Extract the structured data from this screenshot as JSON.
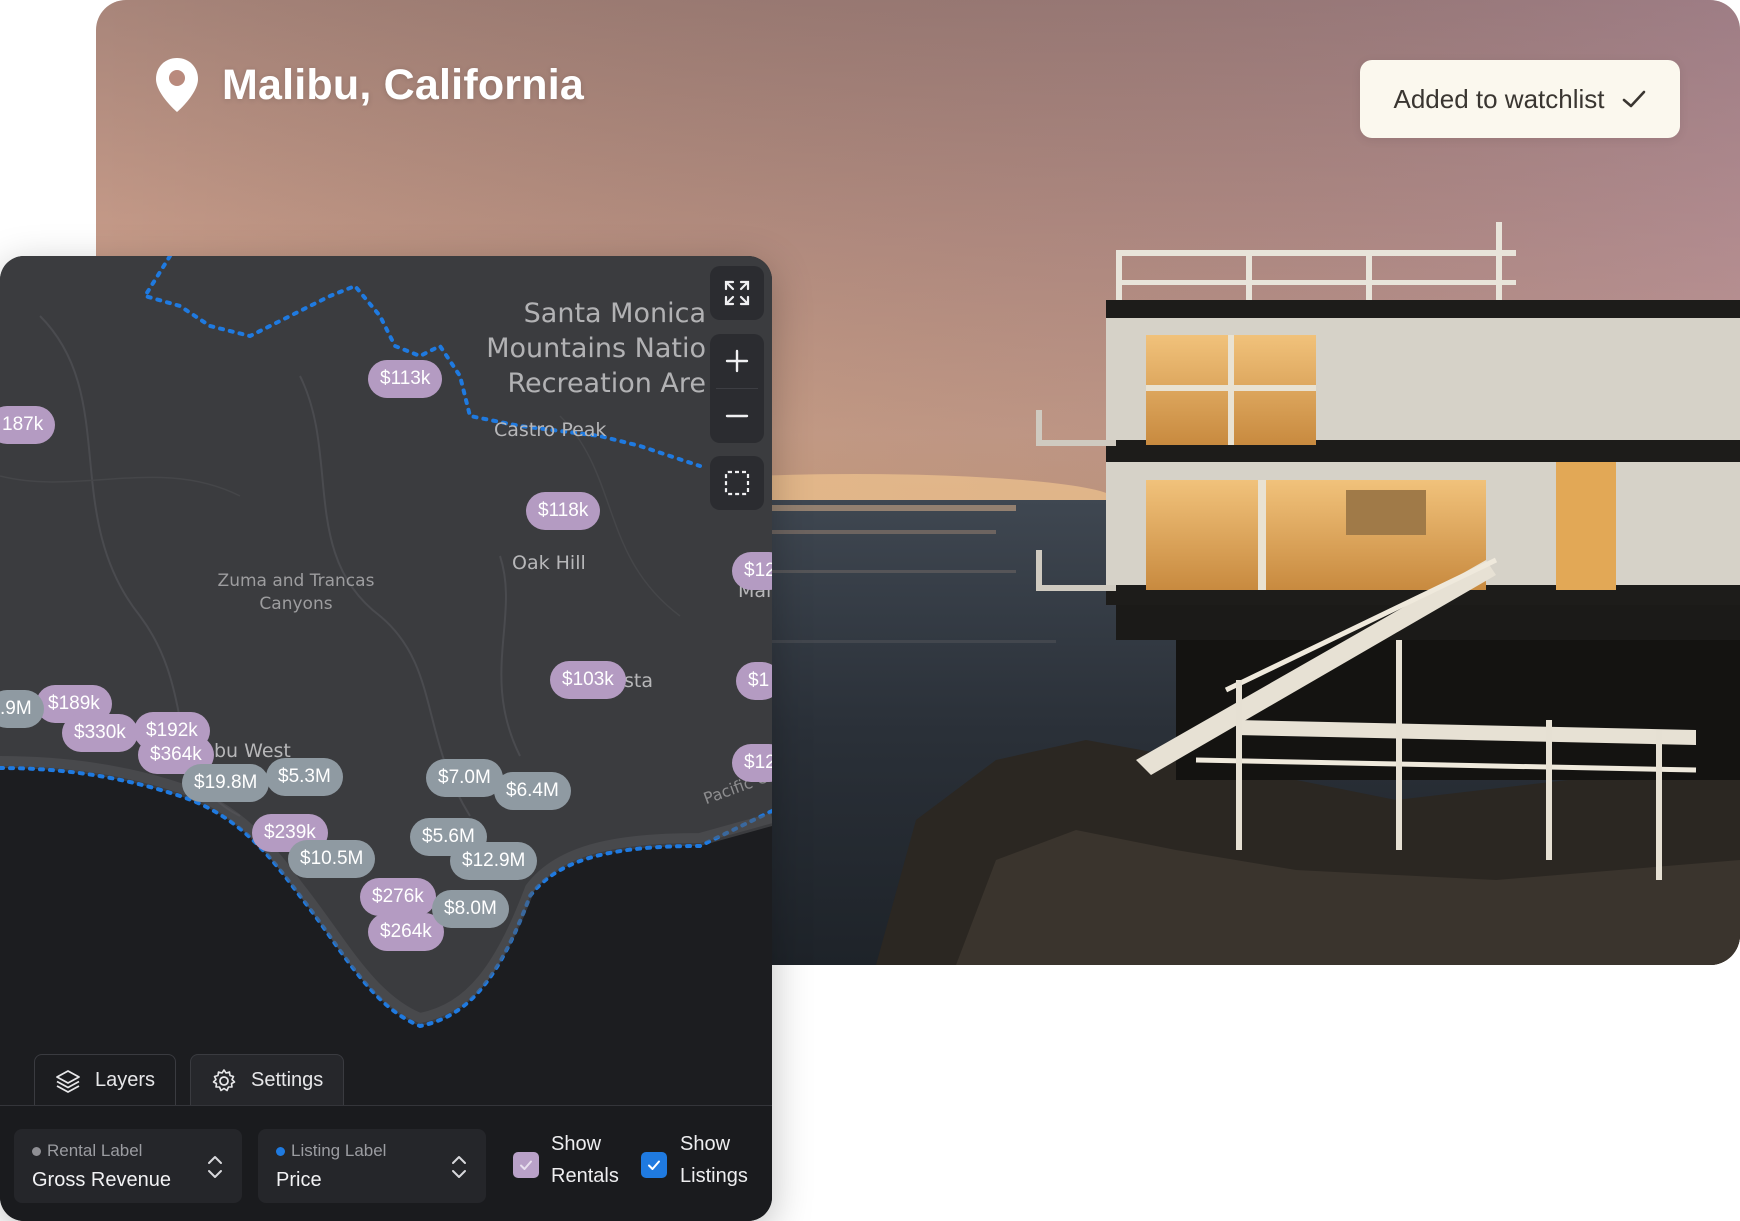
{
  "hero": {
    "location": "Malibu, California",
    "watchlist_label": "Added to watchlist"
  },
  "map": {
    "labels": {
      "santa_monica_1": "Santa Monica",
      "santa_monica_2": "Mountains Natio",
      "santa_monica_3": "Recreation Are",
      "castro_peak": "Castro Peak",
      "oak_hill": "Oak Hill",
      "zuma_1": "Zuma and Trancas",
      "zuma_2": "Canyons",
      "malibu_west": "bu West",
      "vista": "sta",
      "mal": "Mal",
      "pacific": "Pacific O"
    },
    "rental_markers": [
      "$113k",
      "187k",
      "$118k",
      "$12",
      "$103k",
      "$1",
      "$12",
      "$189k",
      "$330k",
      "$192k",
      "$364k",
      "$239k",
      "$276k",
      "$264k"
    ],
    "listing_markers": [
      ".9M",
      "$19.8M",
      "$5.3M",
      "$7.0M",
      "$6.4M",
      "$5.6M",
      "$12.9M",
      "$10.5M",
      "$8.0M"
    ]
  },
  "tabs": {
    "layers": "Layers",
    "settings": "Settings"
  },
  "controls": {
    "rental_label_title": "Rental Label",
    "rental_label_value": "Gross Revenue",
    "listing_label_title": "Listing Label",
    "listing_label_value": "Price",
    "show_rentals_1": "Show",
    "show_rentals_2": "Rentals",
    "show_listings_1": "Show",
    "show_listings_2": "Listings",
    "show_rentals_checked": true,
    "show_listings_checked": true
  },
  "colors": {
    "rental_marker": "#b49bc2",
    "listing_marker": "#8f9aa2",
    "boundary_blue": "#1f7ae0",
    "checkbox_blue": "#1f7ae0",
    "checkbox_lavender": "#b9a1c8"
  }
}
